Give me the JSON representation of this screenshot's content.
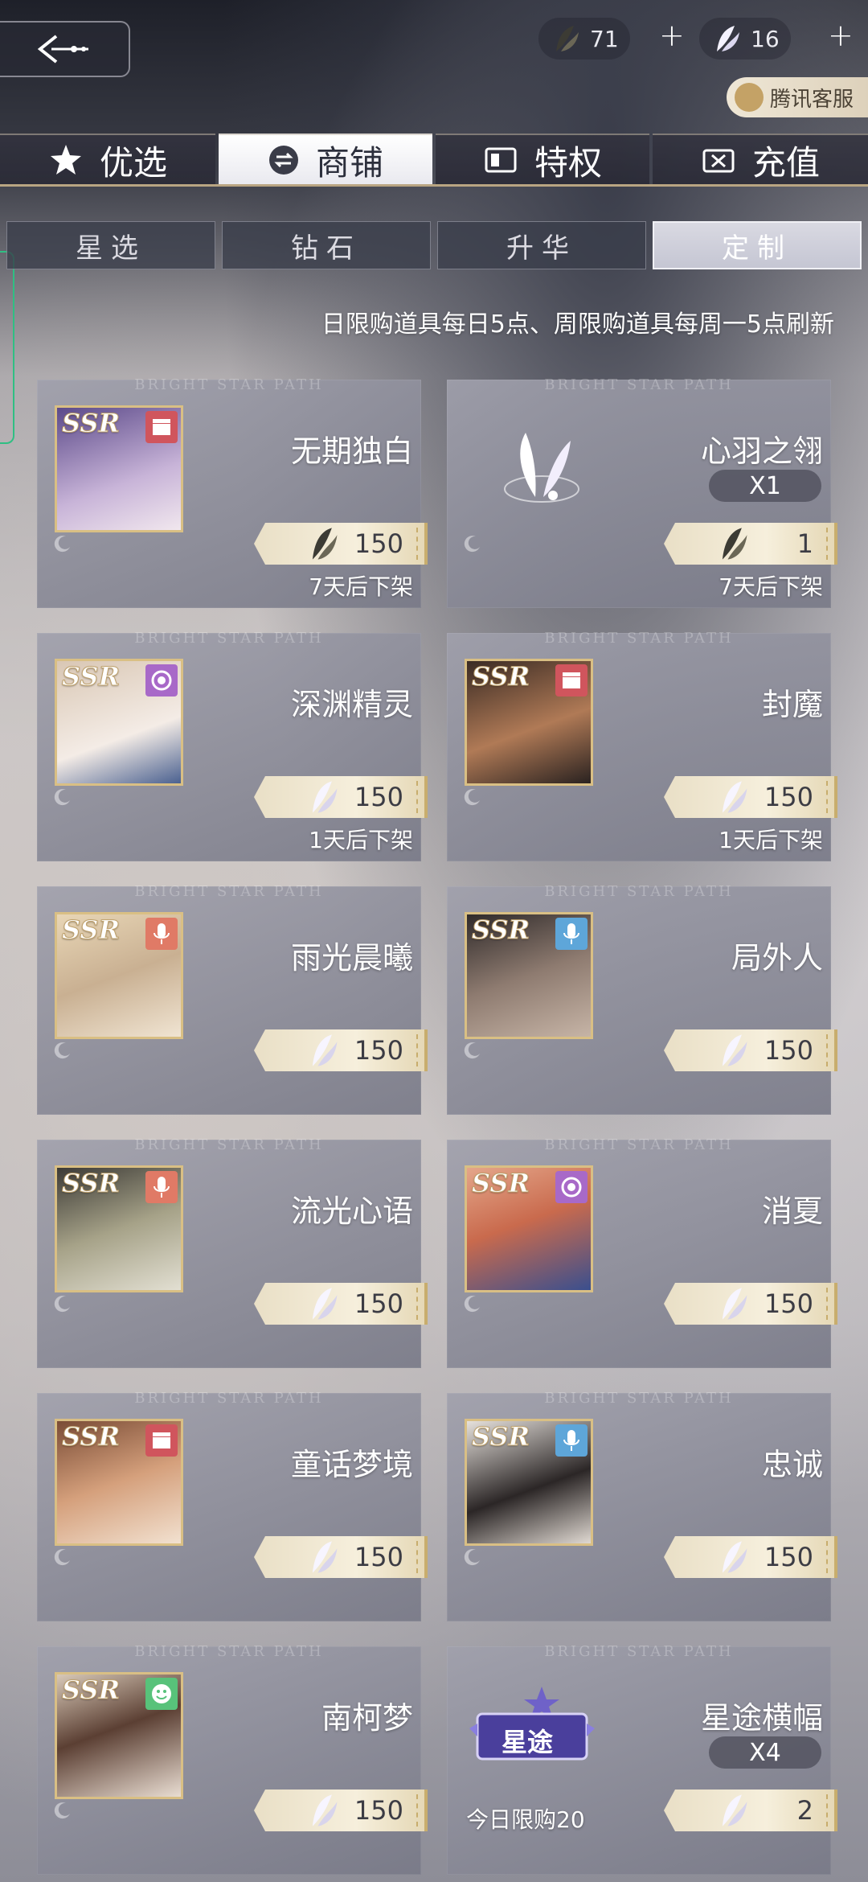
{
  "header": {
    "currency": [
      {
        "icon": "dark-feather-icon",
        "amount": "71"
      },
      {
        "icon": "white-feather-icon",
        "amount": "16"
      }
    ],
    "plus": "+",
    "support_label": "腾讯客服"
  },
  "main_tabs": [
    {
      "label": "优选",
      "icon": "star-icon",
      "active": false
    },
    {
      "label": "商铺",
      "icon": "exchange-icon",
      "active": true
    },
    {
      "label": "特权",
      "icon": "card-icon",
      "active": false
    },
    {
      "label": "充值",
      "icon": "wallet-icon",
      "active": false
    }
  ],
  "sub_tabs": [
    {
      "label": "星选",
      "active": false
    },
    {
      "label": "钻石",
      "active": false
    },
    {
      "label": "升华",
      "active": false
    },
    {
      "label": "定制",
      "active": true
    }
  ],
  "notice": "日限购道具每日5点、周限购道具每周一5点刷新",
  "card_watermark": "BRIGHT STAR PATH",
  "items": [
    {
      "name": "无期独白",
      "ssr": "SSR",
      "badge": "film-icon",
      "badge_color": "#d0555d",
      "currency": "dark-feather-icon",
      "price": "150",
      "expire": "7天后下架"
    },
    {
      "name": "心羽之翎",
      "qty": "X1",
      "currency": "dark-feather-icon",
      "price": "1",
      "expire": "7天后下架",
      "item_icon": "white-feather-icon"
    },
    {
      "name": "深渊精灵",
      "ssr": "SSR",
      "badge": "circle-icon",
      "badge_color": "#a869c8",
      "currency": "white-feather-icon",
      "price": "150",
      "expire": "1天后下架"
    },
    {
      "name": "封魔",
      "ssr": "SSR",
      "badge": "film-icon",
      "badge_color": "#d0555d",
      "currency": "white-feather-icon",
      "price": "150",
      "expire": "1天后下架"
    },
    {
      "name": "雨光晨曦",
      "ssr": "SSR",
      "badge": "mic-icon",
      "badge_color": "#e07a66",
      "currency": "white-feather-icon",
      "price": "150"
    },
    {
      "name": "局外人",
      "ssr": "SSR",
      "badge": "mic-icon",
      "badge_color": "#5ea6d9",
      "currency": "white-feather-icon",
      "price": "150"
    },
    {
      "name": "流光心语",
      "ssr": "SSR",
      "badge": "mic-icon",
      "badge_color": "#e07a66",
      "currency": "white-feather-icon",
      "price": "150"
    },
    {
      "name": "消夏",
      "ssr": "SSR",
      "badge": "circle-icon",
      "badge_color": "#a869c8",
      "currency": "white-feather-icon",
      "price": "150"
    },
    {
      "name": "童话梦境",
      "ssr": "SSR",
      "badge": "film-icon",
      "badge_color": "#d0555d",
      "currency": "white-feather-icon",
      "price": "150"
    },
    {
      "name": "忠诚",
      "ssr": "SSR",
      "badge": "mic-icon",
      "badge_color": "#5ea6d9",
      "currency": "white-feather-icon",
      "price": "150"
    },
    {
      "name": "南柯梦",
      "ssr": "SSR",
      "badge": "smile-icon",
      "badge_color": "#58c27a",
      "currency": "white-feather-icon",
      "price": "150"
    },
    {
      "name": "星途横幅",
      "qty": "X4",
      "currency": "white-feather-icon",
      "price": "2",
      "limit": "今日限购20",
      "banner_text": "星途",
      "item_icon": "banner-icon"
    }
  ]
}
